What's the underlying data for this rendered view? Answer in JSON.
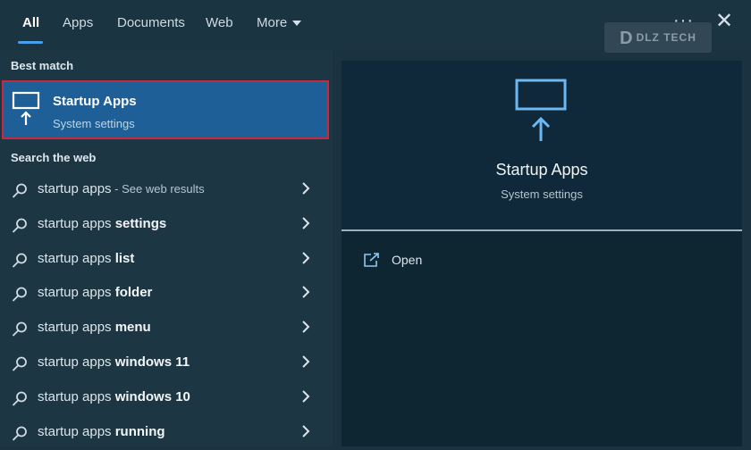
{
  "tabs": [
    {
      "label": "All"
    },
    {
      "label": "Apps"
    },
    {
      "label": "Documents"
    },
    {
      "label": "Web"
    },
    {
      "label": "More"
    }
  ],
  "watermark": {
    "text": "DLZ TECH"
  },
  "best_match": {
    "section_label": "Best match",
    "title": "Startup Apps",
    "subtitle": "System settings"
  },
  "web": {
    "section_label": "Search web",
    "section_label_full": "Search the web",
    "items": [
      {
        "prefix": "startup apps",
        "bold": "",
        "hint": " - See web results"
      },
      {
        "prefix": "startup apps ",
        "bold": "settings",
        "hint": ""
      },
      {
        "prefix": "startup apps ",
        "bold": "list",
        "hint": ""
      },
      {
        "prefix": "startup apps ",
        "bold": "folder",
        "hint": ""
      },
      {
        "prefix": "startup apps ",
        "bold": "menu",
        "hint": ""
      },
      {
        "prefix": "startup apps ",
        "bold": "windows 11",
        "hint": ""
      },
      {
        "prefix": "startup apps ",
        "bold": "windows 10",
        "hint": ""
      },
      {
        "prefix": "startup apps ",
        "bold": "running",
        "hint": ""
      }
    ]
  },
  "preview": {
    "title": "Startup Apps",
    "subtitle": "System settings",
    "action_open": "Open"
  },
  "colors": {
    "accent": "#4aa0e6",
    "selected_bg": "#1f5f97",
    "highlight_border": "#c72a3d"
  }
}
